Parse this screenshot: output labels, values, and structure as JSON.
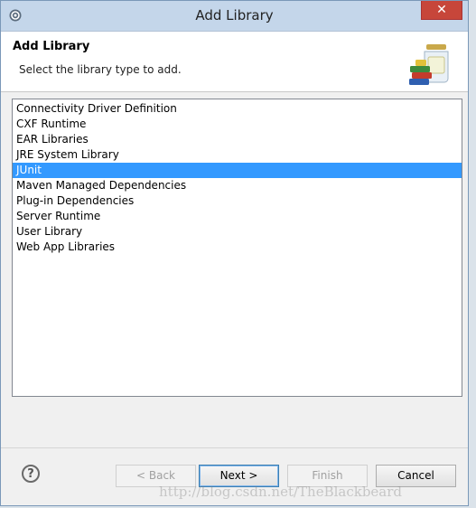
{
  "window": {
    "title": "Add Library",
    "close_label": "✕"
  },
  "banner": {
    "title": "Add Library",
    "description": "Select the library type to add."
  },
  "library_types": {
    "items": [
      "Connectivity Driver Definition",
      "CXF Runtime",
      "EAR Libraries",
      "JRE System Library",
      "JUnit",
      "Maven Managed Dependencies",
      "Plug-in Dependencies",
      "Server Runtime",
      "User Library",
      "Web App Libraries"
    ],
    "selected_index": 4
  },
  "buttons": {
    "help": "?",
    "back": "< Back",
    "next": "Next >",
    "finish": "Finish",
    "cancel": "Cancel"
  },
  "watermark": "http://blog.csdn.net/TheBlackbeard",
  "colors": {
    "selection": "#3399ff",
    "close": "#c7463a",
    "titlebar": "#c4d6ea"
  },
  "icons": {
    "app": "gear-icon",
    "banner": "library-jars-icon",
    "help": "help-icon"
  }
}
